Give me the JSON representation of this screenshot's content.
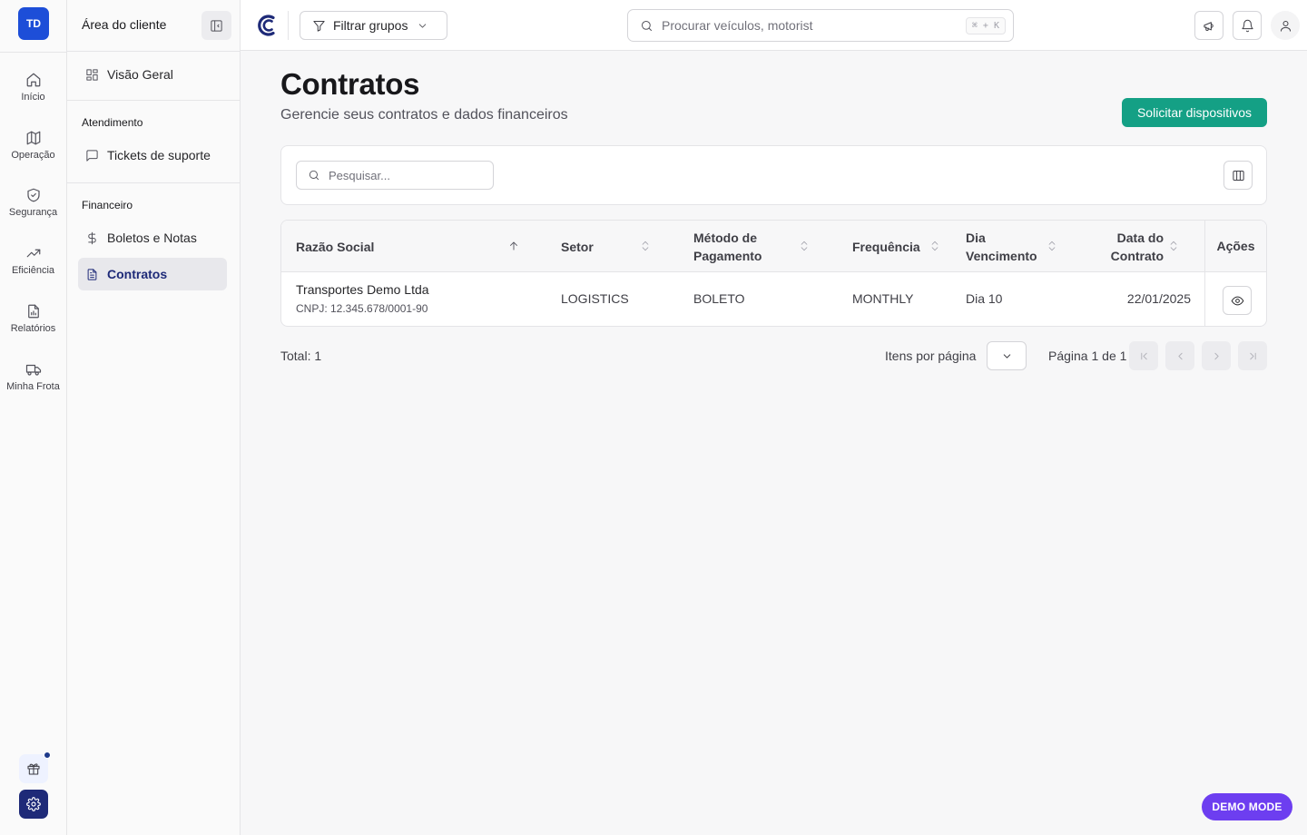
{
  "user": {
    "initials": "TD"
  },
  "rail": {
    "items": [
      {
        "label": "Início",
        "icon": "home-icon"
      },
      {
        "label": "Operação",
        "icon": "map-icon"
      },
      {
        "label": "Segurança",
        "icon": "shield-check-icon"
      },
      {
        "label": "Eficiência",
        "icon": "trending-up-icon"
      },
      {
        "label": "Relatórios",
        "icon": "report-icon"
      },
      {
        "label": "Minha Frota",
        "icon": "truck-icon"
      }
    ]
  },
  "sidebar": {
    "title": "Área do cliente",
    "overview": "Visão Geral",
    "section_service": "Atendimento",
    "tickets": "Tickets de suporte",
    "section_finance": "Financeiro",
    "billing": "Boletos e Notas",
    "contracts": "Contratos"
  },
  "topbar": {
    "filter_label": "Filtrar grupos",
    "search_placeholder": "Procurar veículos, motorist",
    "shortcut": "⌘ + K"
  },
  "page": {
    "title": "Contratos",
    "subtitle": "Gerencie seus contratos e dados financeiros",
    "primary_action": "Solicitar dispositivos"
  },
  "table": {
    "search_placeholder": "Pesquisar...",
    "columns": {
      "company": "Razão Social",
      "sector": "Setor",
      "payment_1": "Método de",
      "payment_2": "Pagamento",
      "frequency": "Frequência",
      "due_1": "Dia",
      "due_2": "Vencimento",
      "date_1": "Data do",
      "date_2": "Contrato",
      "actions": "Ações"
    },
    "rows": [
      {
        "company": "Transportes Demo Ltda",
        "cnpj": "CNPJ: 12.345.678/0001-90",
        "sector": "LOGISTICS",
        "payment": "BOLETO",
        "frequency": "MONTHLY",
        "due": "Dia 10",
        "date": "22/01/2025"
      }
    ]
  },
  "pagination": {
    "total": "Total: 1",
    "per_page_label": "Itens por página",
    "page_info": "Página 1 de 1"
  },
  "badge": {
    "demo": "DEMO MODE"
  },
  "colors": {
    "primary": "#14a085",
    "brand_navy": "#1e2a78",
    "avatar_blue": "#1d4ed8",
    "demo_purple": "#6d3ef0"
  }
}
